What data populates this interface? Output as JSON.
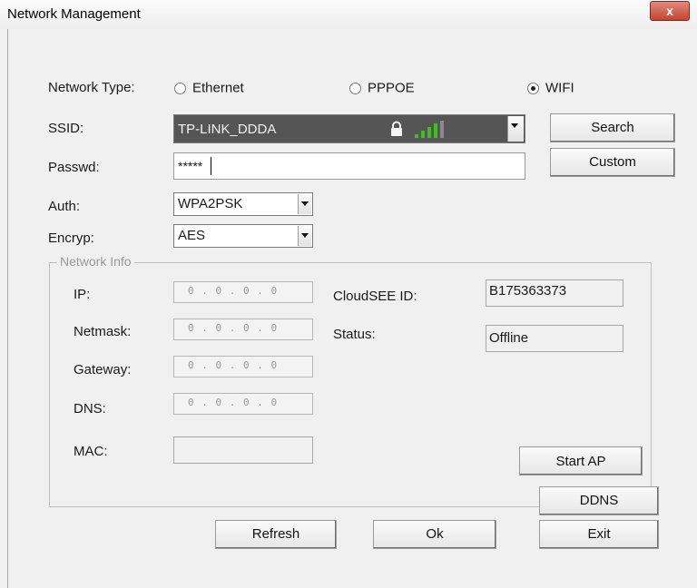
{
  "window": {
    "title": "Network Management",
    "close_label": "x"
  },
  "network_type": {
    "label": "Network Type:",
    "options": [
      {
        "label": "Ethernet",
        "selected": false
      },
      {
        "label": "PPPOE",
        "selected": false
      },
      {
        "label": "WIFI",
        "selected": true
      }
    ]
  },
  "ssid": {
    "label": "SSID:",
    "value": "TP-LINK_DDDA",
    "secured": true,
    "signal_bars": 4,
    "signal_strength": 0.75
  },
  "passwd": {
    "label": "Passwd:",
    "value": "*****"
  },
  "auth": {
    "label": "Auth:",
    "value": "WPA2PSK"
  },
  "encryp": {
    "label": "Encryp:",
    "value": "AES"
  },
  "buttons": {
    "search": "Search",
    "custom": "Custom",
    "start_ap": "Start AP",
    "ddns": "DDNS",
    "refresh": "Refresh",
    "ok": "Ok",
    "exit": "Exit"
  },
  "network_info": {
    "title": "Network Info",
    "ip": {
      "label": "IP:",
      "value": "0 . 0 . 0 . 0"
    },
    "netmask": {
      "label": "Netmask:",
      "value": "0 . 0 . 0 . 0"
    },
    "gateway": {
      "label": "Gateway:",
      "value": "0 . 0 . 0 . 0"
    },
    "dns": {
      "label": "DNS:",
      "value": "0 . 0 . 0 . 0"
    },
    "mac": {
      "label": "MAC:",
      "value": ""
    },
    "cloudsee_id": {
      "label": "CloudSEE ID:",
      "value": "B175363373"
    },
    "status": {
      "label": "Status:",
      "value": "Offline"
    }
  },
  "colors": {
    "ssid_bg": "#555555",
    "signal_green": "#3fbf1f",
    "close_red": "#c5452f"
  }
}
